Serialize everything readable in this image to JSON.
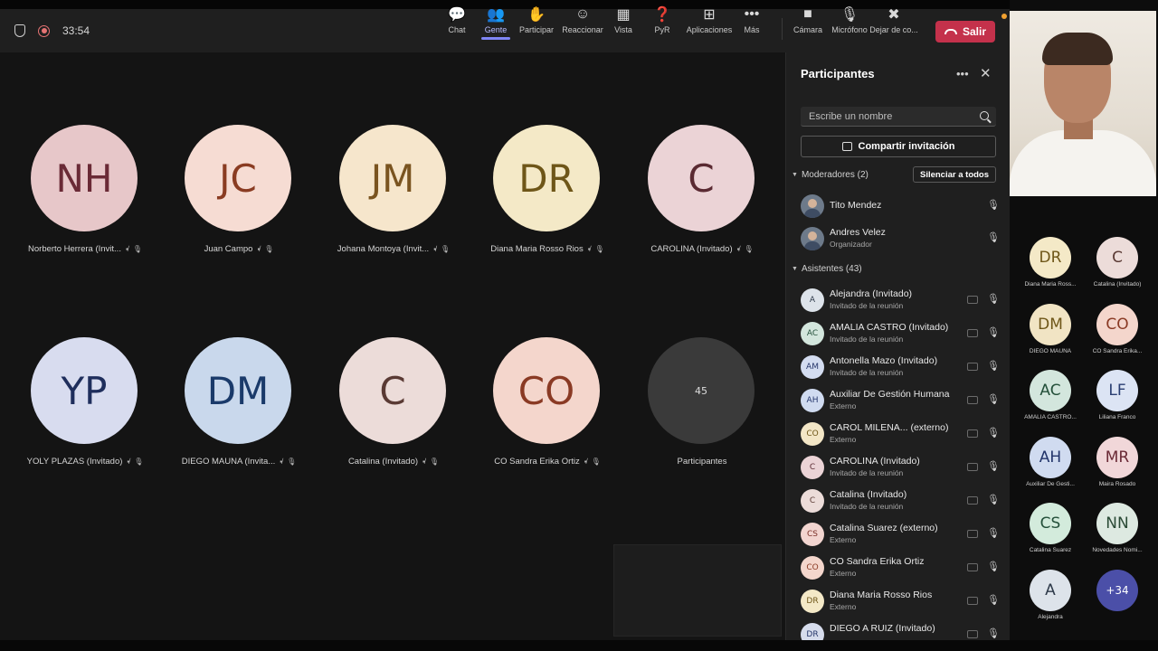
{
  "colors": {
    "toolbar_bg": "#1f1f1f",
    "stage_bg": "#141414",
    "panel_bg": "#1f1f1f",
    "leave_button": "#c4314b",
    "active_tab": "#7f85f5"
  },
  "toolbar": {
    "timer": "33:54",
    "buttons": [
      {
        "label": "Chat",
        "icon": "chat-icon",
        "glyph": "💬"
      },
      {
        "label": "Gente",
        "icon": "people-icon",
        "glyph": "👥"
      },
      {
        "label": "Participar",
        "icon": "raise-hand-icon",
        "glyph": "✋"
      },
      {
        "label": "Reaccionar",
        "icon": "smile-icon",
        "glyph": "☺"
      },
      {
        "label": "Vista",
        "icon": "grid-view-icon",
        "glyph": "▦"
      },
      {
        "label": "PyR",
        "icon": "qa-icon",
        "glyph": "❓"
      },
      {
        "label": "Aplicaciones",
        "icon": "add-apps-icon",
        "glyph": "⊞"
      },
      {
        "label": "Más",
        "icon": "more-icon",
        "glyph": "•••"
      }
    ],
    "media": [
      {
        "label": "Cámara",
        "icon": "camera-icon",
        "glyph": "■"
      },
      {
        "label": "Micrófono",
        "icon": "microphone-icon",
        "glyph": "🎙"
      },
      {
        "label": "Dejar de co...",
        "icon": "stop-share-icon",
        "glyph": "✖"
      }
    ],
    "leave_label": "Salir"
  },
  "stage": {
    "tiles": [
      {
        "initials": "NH",
        "name": "Norberto Herrera (Invit...",
        "bg": "#e7c7c9",
        "fg": "#6a2a36"
      },
      {
        "initials": "JC",
        "name": "Juan Campo",
        "bg": "#f6dcd3",
        "fg": "#8a3c22"
      },
      {
        "initials": "JM",
        "name": "Johana Montoya (Invit...",
        "bg": "#f6e6cc",
        "fg": "#7a5420"
      },
      {
        "initials": "DR",
        "name": "Diana Maria Rosso Rios",
        "bg": "#f4e9c7",
        "fg": "#6e5618"
      },
      {
        "initials": "C",
        "name": "CAROLINA (Invitado)",
        "bg": "#ebd3d6",
        "fg": "#5a2a32"
      },
      {
        "initials": "YP",
        "name": "YOLY PLAZAS (Invitado)",
        "bg": "#d8dcef",
        "fg": "#1f2e5c"
      },
      {
        "initials": "DM",
        "name": "DIEGO MAUNA (Invita...",
        "bg": "#c9d8ec",
        "fg": "#1a3a6a"
      },
      {
        "initials": "C",
        "name": "Catalina (Invitado)",
        "bg": "#ecdcd9",
        "fg": "#5a3a34"
      },
      {
        "initials": "CO",
        "name": "CO Sandra Erika Ortiz",
        "bg": "#f4d6cc",
        "fg": "#8a3a24"
      }
    ],
    "more_count": "45",
    "more_label": "Participantes"
  },
  "panel": {
    "title": "Participantes",
    "search_placeholder": "Escribe un nombre",
    "share_label": "Compartir invitación",
    "moderators_label": "Moderadores (2)",
    "mute_all_label": "Silenciar a todos",
    "moderators": [
      {
        "name": "Tito Mendez",
        "sub": ""
      },
      {
        "name": "Andres Velez",
        "sub": "Organizador"
      }
    ],
    "attendees_label": "Asistentes (43)",
    "attendees": [
      {
        "initials": "A",
        "name": "Alejandra (Invitado)",
        "sub": "Invitado de la reunión",
        "bg": "#dde3ea",
        "fg": "#2e3a4a"
      },
      {
        "initials": "AC",
        "name": "AMALIA CASTRO (Invitado)",
        "sub": "Invitado de la reunión",
        "bg": "#d3e6dd",
        "fg": "#24503a"
      },
      {
        "initials": "AM",
        "name": "Antonella Mazo (Invitado)",
        "sub": "Invitado de la reunión",
        "bg": "#d3dcf0",
        "fg": "#26366a"
      },
      {
        "initials": "AH",
        "name": "Auxiliar De Gestión Humana",
        "sub": "Externo",
        "bg": "#d0dbf0",
        "fg": "#22346a"
      },
      {
        "initials": "CO",
        "name": "CAROL MILENA... (externo)",
        "sub": "Externo",
        "bg": "#f3e6c6",
        "fg": "#6e5618"
      },
      {
        "initials": "C",
        "name": "CAROLINA (Invitado)",
        "sub": "Invitado de la reunión",
        "bg": "#ebd3d6",
        "fg": "#5a2a32"
      },
      {
        "initials": "C",
        "name": "Catalina (Invitado)",
        "sub": "Invitado de la reunión",
        "bg": "#ecdcd9",
        "fg": "#5a3a34"
      },
      {
        "initials": "CS",
        "name": "Catalina Suarez (externo)",
        "sub": "Externo",
        "bg": "#f2d5d0",
        "fg": "#7a3028"
      },
      {
        "initials": "CO",
        "name": "CO Sandra Erika Ortiz",
        "sub": "Externo",
        "bg": "#f4d6cc",
        "fg": "#8a3a24"
      },
      {
        "initials": "DR",
        "name": "Diana Maria Rosso Rios",
        "sub": "Externo",
        "bg": "#f4e9c7",
        "fg": "#6e5618"
      },
      {
        "initials": "DR",
        "name": "DIEGO A RUIZ (Invitado)",
        "sub": "",
        "bg": "#d6dcec",
        "fg": "#26366a"
      }
    ]
  },
  "gallery": {
    "tiles": [
      {
        "initials": "DR",
        "name": "Diana Maria Ross...",
        "bg": "#f4e9c7",
        "fg": "#6e5618"
      },
      {
        "initials": "C",
        "name": "Catalina (Invitado)",
        "bg": "#ecdcd9",
        "fg": "#5a3a34"
      },
      {
        "initials": "DM",
        "name": "DIEGO MAUNA",
        "bg": "#f1e4c4",
        "fg": "#6e5618"
      },
      {
        "initials": "CO",
        "name": "CO Sandra Erika...",
        "bg": "#f4d6cc",
        "fg": "#8a3a24"
      },
      {
        "initials": "AC",
        "name": "AMALIA  CASTRO...",
        "bg": "#d3e6dd",
        "fg": "#24503a"
      },
      {
        "initials": "LF",
        "name": "Liliana Franco",
        "bg": "#dce4f4",
        "fg": "#2a3e72"
      },
      {
        "initials": "AH",
        "name": "Auxiliar De Gesti...",
        "bg": "#d0dbf0",
        "fg": "#22346a"
      },
      {
        "initials": "MR",
        "name": "Maira Rosado",
        "bg": "#f1d7d9",
        "fg": "#6a2a36"
      },
      {
        "initials": "CS",
        "name": "Catalina Suarez",
        "bg": "#d3ebdc",
        "fg": "#24503a"
      },
      {
        "initials": "NN",
        "name": "Novedades Nomi...",
        "bg": "#dde9e1",
        "fg": "#2a4a36"
      },
      {
        "initials": "A",
        "name": "Alejandra",
        "bg": "#dde3ea",
        "fg": "#2e3a4a"
      },
      {
        "initials": "+34",
        "name": "",
        "bg": "#4b4fa8",
        "fg": "#ffffff"
      }
    ]
  }
}
